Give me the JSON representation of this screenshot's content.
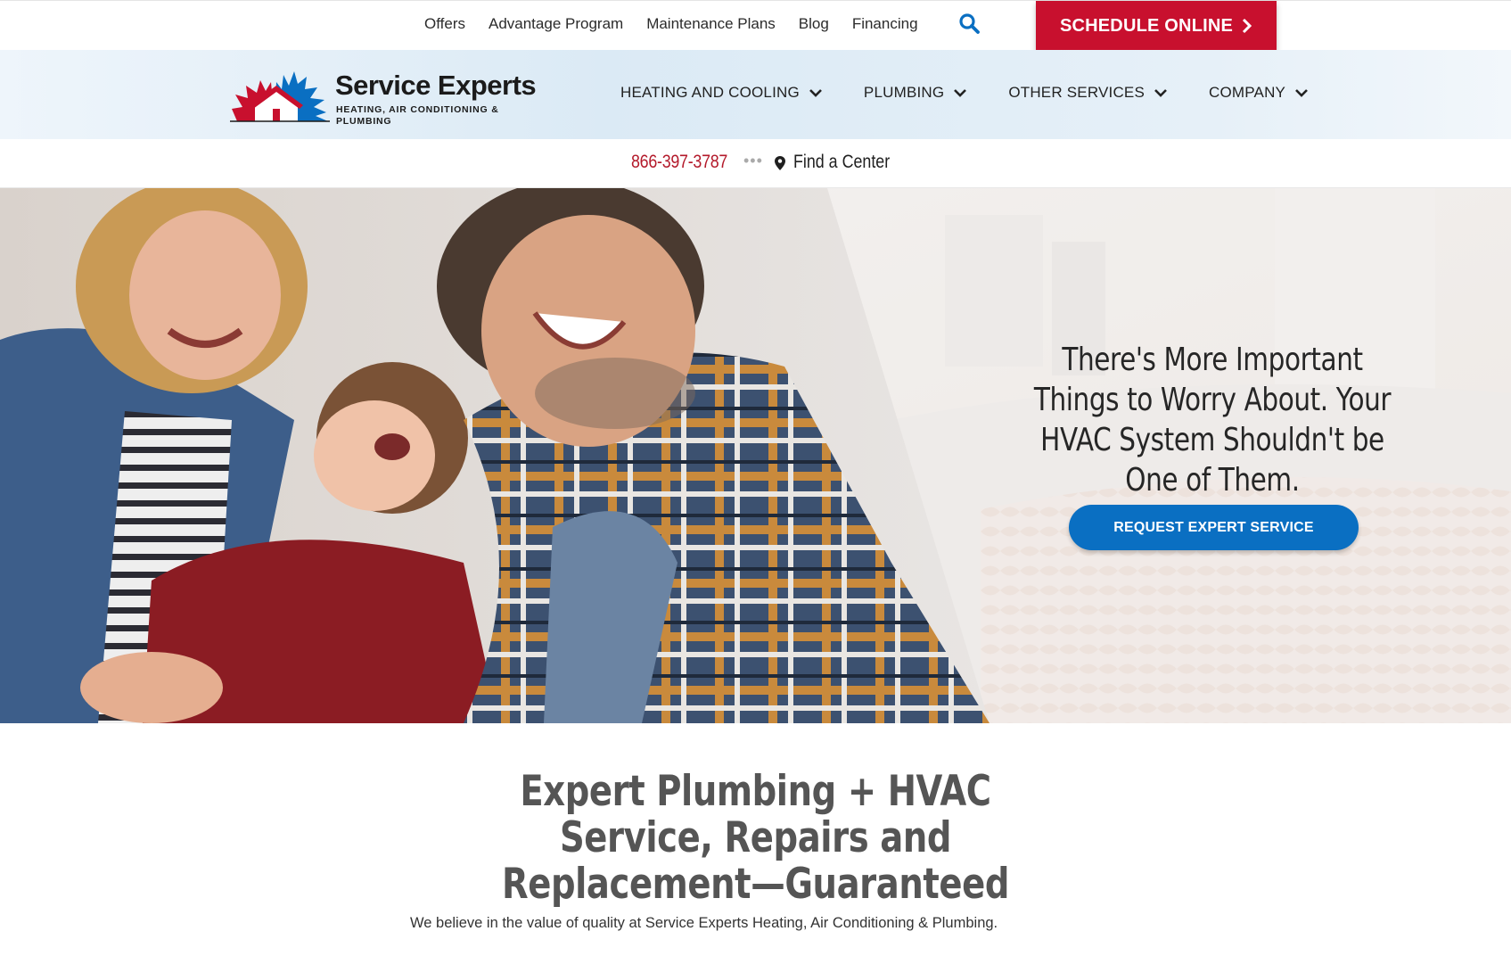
{
  "utility_nav": {
    "links": [
      "Offers",
      "Advantage Program",
      "Maintenance Plans",
      "Blog",
      "Financing"
    ],
    "schedule_label": "SCHEDULE ONLINE"
  },
  "brand": {
    "name": "Service Experts",
    "tagline": "HEATING, AIR CONDITIONING & PLUMBING",
    "colors": {
      "red": "#c8102e",
      "blue": "#0a6fc2",
      "dark": "#1b1b1b"
    }
  },
  "main_nav": {
    "items": [
      "HEATING AND COOLING",
      "PLUMBING",
      "OTHER SERVICES",
      "COMPANY"
    ]
  },
  "contact": {
    "phone": "866-397-3787",
    "separator": "•••",
    "find_center": "Find a Center"
  },
  "hero": {
    "heading": "There's More Important Things to Worry About. Your HVAC System Shouldn't be One of Them.",
    "cta_label": "REQUEST EXPERT SERVICE"
  },
  "intro": {
    "title": "Expert Plumbing + HVAC Service, Repairs and Replacement—Guaranteed",
    "body": "We believe in the value of quality at Service Experts Heating, Air Conditioning & Plumbing."
  },
  "icons": [
    "search-icon",
    "chevron-right-icon",
    "chevron-down-icon",
    "map-pin-icon",
    "logo-icon"
  ]
}
